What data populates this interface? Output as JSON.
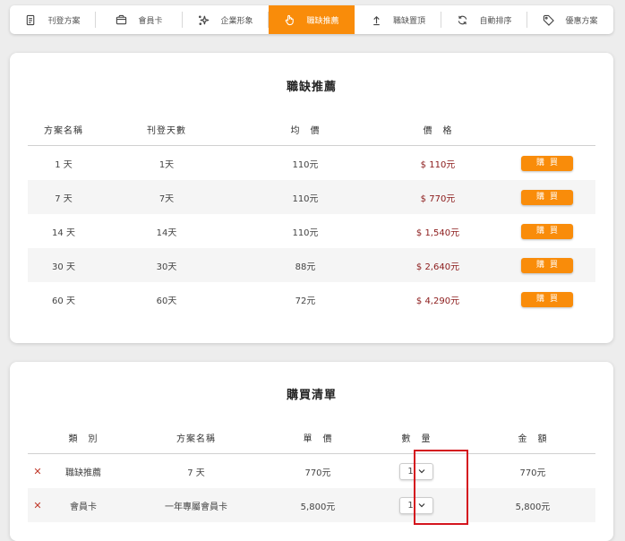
{
  "tabs": [
    {
      "label": "刊登方案",
      "icon": "document-icon"
    },
    {
      "label": "會員卡",
      "icon": "card-icon"
    },
    {
      "label": "企業形象",
      "icon": "sparkle-icon"
    },
    {
      "label": "職缺推薦",
      "icon": "hand-pointer-icon"
    },
    {
      "label": "職缺置頂",
      "icon": "arrow-up-icon"
    },
    {
      "label": "自動排序",
      "icon": "refresh-icon"
    },
    {
      "label": "優惠方案",
      "icon": "tag-icon"
    }
  ],
  "active_tab": 3,
  "recommend": {
    "title": "職缺推薦",
    "headers": [
      "方案名稱",
      "刊登天數",
      "均　價",
      "價　格"
    ],
    "rows": [
      {
        "name": "1 天",
        "days": "1天",
        "avg": "110元",
        "price": "$ 110元",
        "action": "購買"
      },
      {
        "name": "7 天",
        "days": "7天",
        "avg": "110元",
        "price": "$ 770元",
        "action": "購買"
      },
      {
        "name": "14 天",
        "days": "14天",
        "avg": "110元",
        "price": "$ 1,540元",
        "action": "購買"
      },
      {
        "name": "30 天",
        "days": "30天",
        "avg": "88元",
        "price": "$ 2,640元",
        "action": "購買"
      },
      {
        "name": "60 天",
        "days": "60天",
        "avg": "72元",
        "price": "$ 4,290元",
        "action": "購買"
      }
    ]
  },
  "cart": {
    "title": "購買清單",
    "headers": [
      "類　別",
      "方案名稱",
      "單　價",
      "數　量",
      "金　額"
    ],
    "rows": [
      {
        "remove": "✕",
        "category": "職缺推薦",
        "plan": "7 天",
        "unit": "770元",
        "qty": "1",
        "amount": "770元"
      },
      {
        "remove": "✕",
        "category": "會員卡",
        "plan": "一年專屬會員卡",
        "unit": "5,800元",
        "qty": "1",
        "amount": "5,800元"
      }
    ]
  },
  "colors": {
    "accent": "#f98c0a",
    "price": "#8b1a1a",
    "highlight": "#d4141e"
  }
}
